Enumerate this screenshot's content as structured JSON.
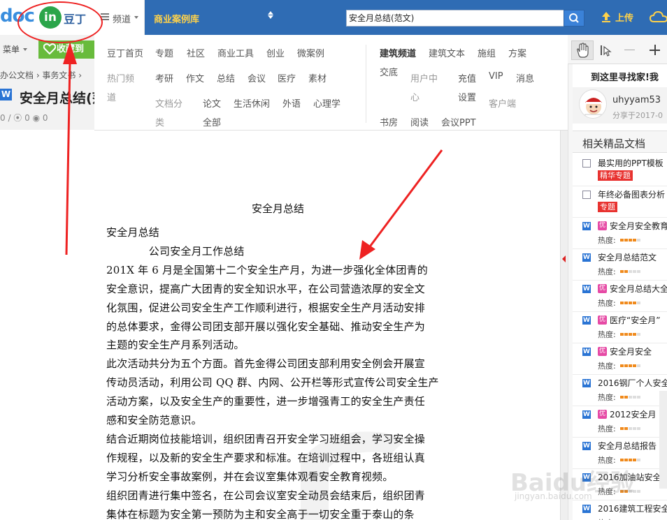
{
  "header": {
    "logo_text": "doc",
    "logo_in": "in",
    "logo_cn": "豆丁",
    "channel_label": "频道",
    "case_library": "商业案例库",
    "search_value": "安全月总结(范文)",
    "upload_label": "上传",
    "accent": "#2f6cb4"
  },
  "left_bar": {
    "menu_label": "菜单",
    "favorite_label": "收藏到",
    "breadcrumb": "办公文档 › 事务文书 ›",
    "doc_title": "安全月总结(范",
    "stats": "0 / ⦿ 0   ◉ 0"
  },
  "dropdown": {
    "row1": [
      "豆丁首页",
      "专题",
      "社区",
      "商业工具",
      "创业",
      "微案例"
    ],
    "row1_right": [
      "建筑频道",
      "建筑文本",
      "施组",
      "方案"
    ],
    "jiaoyi": "交底",
    "hot_channel_line1": "热门频",
    "hot_channel_line2": "道",
    "row2": [
      "考研",
      "作文",
      "总结",
      "会议",
      "医疗",
      "素材"
    ],
    "user_center_line1": "用户中",
    "user_center_line2": "心",
    "recharge": "充值",
    "settings": "设置",
    "vip": "VIP",
    "messages": "消息",
    "client": "客户端",
    "doc_cat_line1": "文档分",
    "doc_cat_line2": "类",
    "row3": [
      "论文",
      "生活休闲",
      "外语",
      "心理学"
    ],
    "all": "全部",
    "row4_right": [
      "书房",
      "阅读",
      "会议PPT"
    ]
  },
  "toolbar": {
    "hand_tool": "hand",
    "select_tool": "select"
  },
  "sidebar": {
    "find_text": "到这里寻找家!我",
    "username": "uhyyam53",
    "shared": "分享于2017-0",
    "related_title": "相关精品文档",
    "items": [
      {
        "name": "最实用的PPT模板",
        "tag": "精华专题",
        "kind": "ppt"
      },
      {
        "name": "年终必备图表分析",
        "tag": "专题",
        "kind": "ppt"
      },
      {
        "name": "安全月安全教育",
        "heat_label": "热度:",
        "heat": 0.8,
        "kind": "w",
        "you": true
      },
      {
        "name": "安全月总结范文",
        "heat_label": "热度:",
        "heat": 0.4,
        "kind": "w",
        "you": false
      },
      {
        "name": "安全月总结大全",
        "heat_label": "热度:",
        "heat": 0.8,
        "kind": "w",
        "you": true
      },
      {
        "name": "医疗“安全月”",
        "heat_label": "热度:",
        "heat": 0.8,
        "kind": "w",
        "you": true
      },
      {
        "name": "安全月安全",
        "heat_label": "热度:",
        "heat": 0.8,
        "kind": "w",
        "you": true
      },
      {
        "name": "2016钢厂个人安全",
        "heat_label": "热度:",
        "heat": 0.4,
        "kind": "w",
        "you": false
      },
      {
        "name": "2012安全月",
        "heat_label": "热度:",
        "heat": 0.4,
        "kind": "w",
        "you": true
      },
      {
        "name": "安全月总结报告",
        "heat_label": "热度:",
        "heat": 0.8,
        "kind": "w",
        "you": false
      },
      {
        "name": "2016加油站安全",
        "heat_label": "热度:",
        "heat": 0.4,
        "kind": "w",
        "you": false
      },
      {
        "name": "2016建筑工程安全",
        "heat_label": "热度:",
        "heat": 0.4,
        "kind": "w",
        "you": false
      }
    ]
  },
  "document": {
    "heading": "安全月总结",
    "lines": [
      "安全月总结",
      "　　　　公司安全月工作总结",
      "201X 年 6 月是全国第十二个安全生产月，为进一步强化全体团青的",
      "安全意识，提高广大团青的安全知识水平，在公司营造浓厚的安全文",
      "化氛围，促进公司安全生产工作顺利进行，根据安全生产月活动安排",
      "的总体要求，金得公司团支部开展以强化安全基础、推动安全生产为",
      "主题的安全生产月系列活动。",
      "此次活动共分为五个方面。首先金得公司团支部利用安全例会开展宣",
      "传动员活动，利用公司 QQ 群、内网、公开栏等形式宣传公司安全生产",
      "活动方案，以及安全生产的重要性，进一步增强青工的安全生产责任",
      "感和安全防范意识。",
      "结合近期岗位技能培训，组织团青召开安全学习班组会，学习安全操",
      "作规程，以及新的安全生产要求和标准。在培训过程中，各班组认真",
      "学习分析安全事故案例，并在会议室集体观看安全教育视频。",
      "组织团青进行集中签名，在公司会议室安全动员会结束后，组织团青",
      "集体在标题为安全第一预防为主和安全高于一切安全重于泰山的条"
    ]
  },
  "watermark": {
    "main": "Baidu经验",
    "sub": "jingyan.baidu.com"
  }
}
